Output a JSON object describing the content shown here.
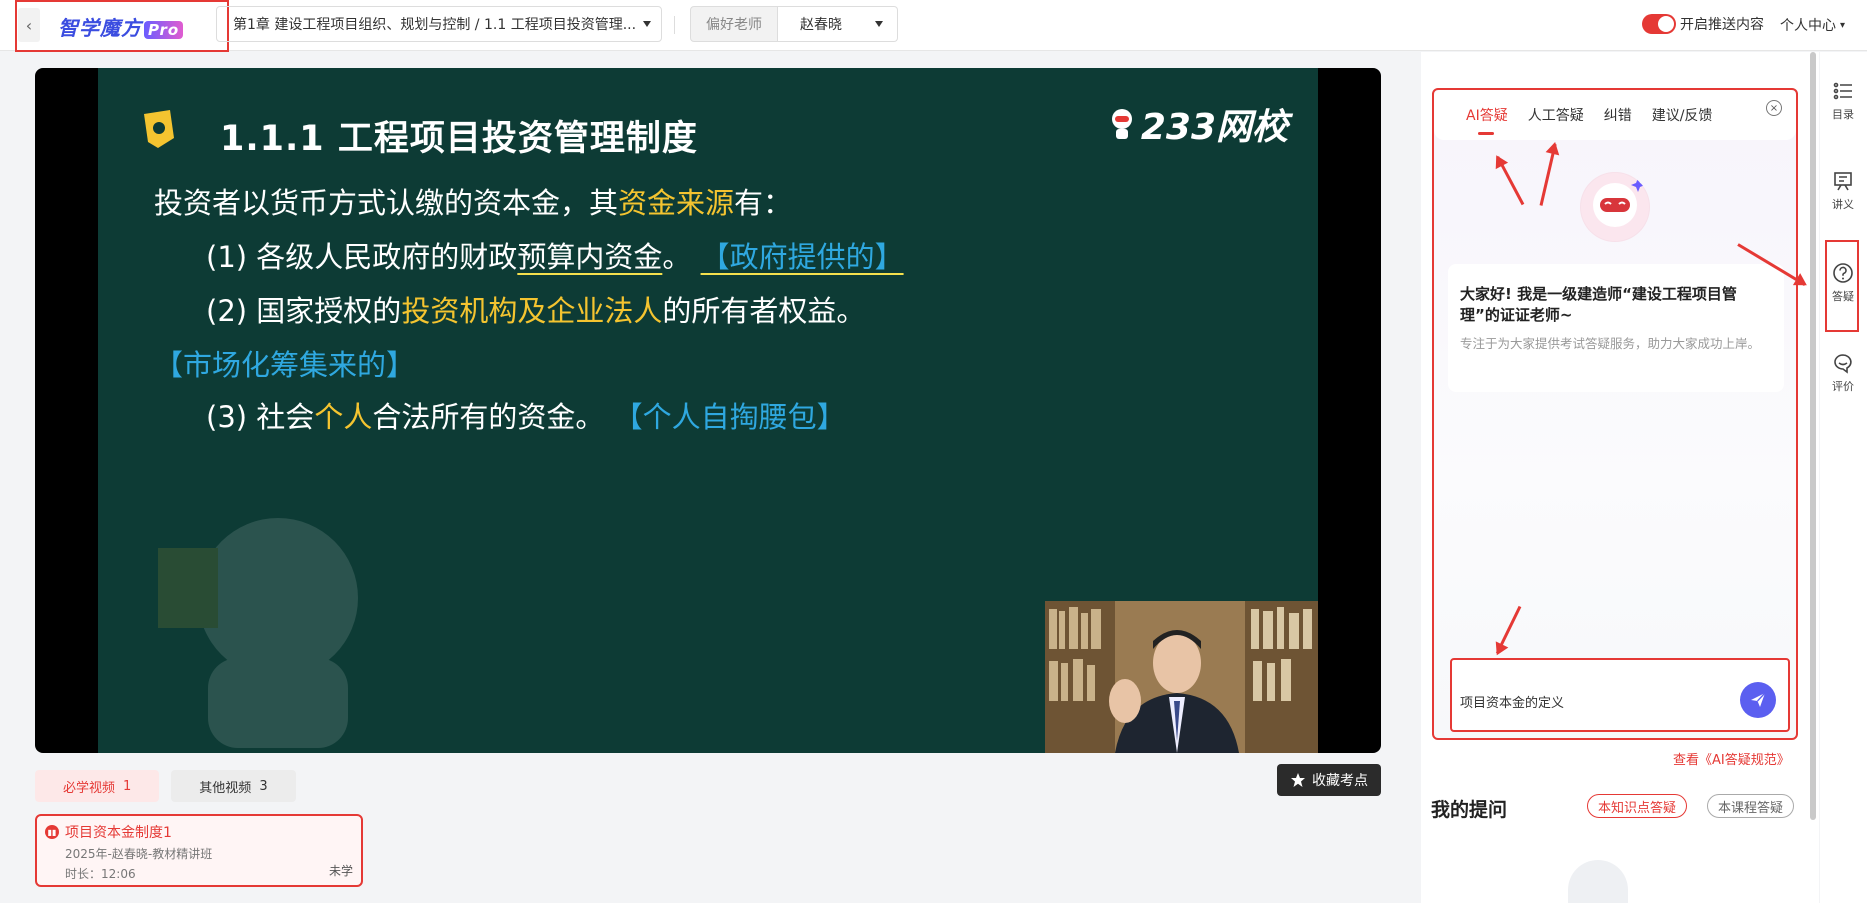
{
  "topbar": {
    "logo_text": "智学魔方",
    "logo_badge": "Pro",
    "chapter": "第1章 建设工程项目组织、规划与控制 / 1.1 工程项目投资管理...",
    "teacher_label": "偏好老师",
    "teacher_name": "赵春晓",
    "push_label": "开启推送内容",
    "personal_center": "个人中心"
  },
  "slide": {
    "title": "1.1.1  工程项目投资管理制度",
    "brand": "233网校",
    "line1_a": "投资者以货币方式认缴的资本金，其",
    "line1_hl": "资金来源",
    "line1_b": "有：",
    "line2_a": "(1) 各级人民政府的财政",
    "line2_ul": "预算内资金",
    "line2_b": "。",
    "line2_tag": "【政府提供的】",
    "line3_a": "(2) 国家授权的",
    "line3_hl": "投资机构及企业法人",
    "line3_b": "的所有者权益。",
    "line4_tag": "【市场化筹集来的】",
    "line5_a": "(3) 社会",
    "line5_hl": "个人",
    "line5_b": "合法所有的资金。",
    "line5_tag": "【个人自掏腰包】"
  },
  "video_tabs": [
    {
      "label": "必学视频",
      "count": "1"
    },
    {
      "label": "其他视频",
      "count": "3"
    }
  ],
  "collect_label": "收藏考点",
  "lesson": {
    "title": "项目资本金制度1",
    "subtitle": "2025年-赵春晓-教材精讲班",
    "duration": "时长：12:06",
    "status": "未学"
  },
  "qa": {
    "tabs": [
      "AI答疑",
      "人工答疑",
      "纠错",
      "建议/反馈"
    ],
    "greeting": "大家好! 我是一级建造师“建设工程项目管理”的证证老师~",
    "description": "专注于为大家提供考试答疑服务，助力大家成功上岸。",
    "input_value": "项目资本金的定义",
    "spec_link": "查看《AI答疑规范》"
  },
  "my_questions": {
    "title": "我的提问",
    "chip_active": "本知识点答疑",
    "chip_inactive": "本课程答疑"
  },
  "side_nav": [
    "目录",
    "讲义",
    "答疑",
    "评价"
  ],
  "colors": {
    "accent": "#e53935",
    "slide_bg": "#0d3b35",
    "highlight_yellow": "#f4c430",
    "highlight_blue": "#2fa8e0",
    "send_button": "#5b5ff0"
  }
}
